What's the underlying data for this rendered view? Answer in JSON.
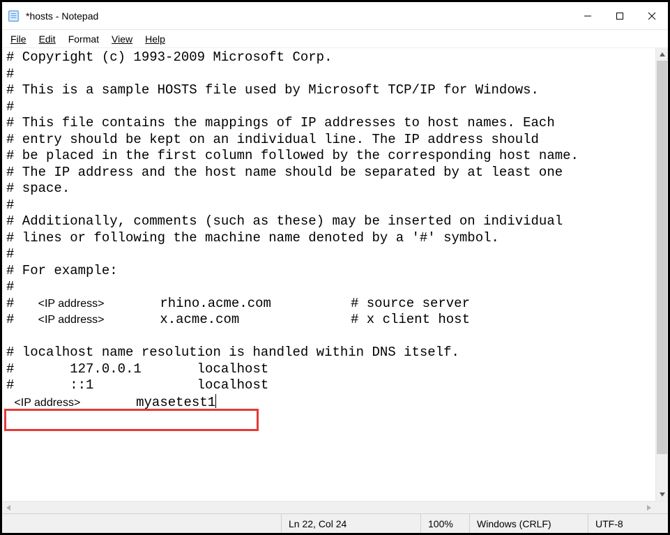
{
  "window": {
    "title": "*hosts - Notepad"
  },
  "menu": {
    "file": "File",
    "edit": "Edit",
    "format": "Format",
    "view": "View",
    "help": "Help"
  },
  "hosts_file": {
    "lines": [
      "# Copyright (c) 1993-2009 Microsoft Corp.",
      "#",
      "# This is a sample HOSTS file used by Microsoft TCP/IP for Windows.",
      "#",
      "# This file contains the mappings of IP addresses to host names. Each",
      "# entry should be kept on an individual line. The IP address should",
      "# be placed in the first column followed by the corresponding host name.",
      "# The IP address and the host name should be separated by at least one",
      "# space.",
      "#",
      "# Additionally, comments (such as these) may be inserted on individual",
      "# lines or following the machine name denoted by a '#' symbol.",
      "#",
      "# For example:",
      "#"
    ],
    "example1_prefix": "#   ",
    "example_ip_placeholder": "<IP address>",
    "example1_host": "       rhino.acme.com          # source server",
    "example2_prefix": "#   ",
    "example2_host": "       x.acme.com              # x client host",
    "tail": [
      "",
      "# localhost name resolution is handled within DNS itself.",
      "#       127.0.0.1       localhost",
      "#       ::1             localhost"
    ],
    "new_entry_ip_placeholder": "<IP address>",
    "new_entry_host": "       myasetest1"
  },
  "status": {
    "position": "Ln 22, Col 24",
    "zoom": "100%",
    "line_ending": "Windows (CRLF)",
    "encoding": "UTF-8"
  }
}
